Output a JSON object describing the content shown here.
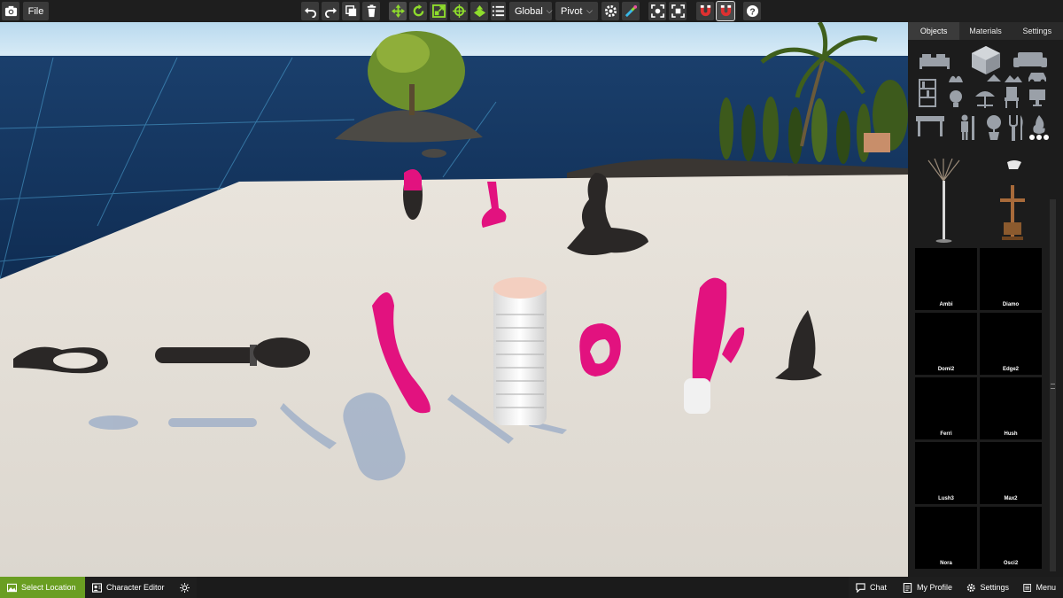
{
  "toolbar": {
    "file_label": "File",
    "space_select": "Global",
    "pivot_select": "Pivot",
    "help_label": "?"
  },
  "panel": {
    "tabs": [
      {
        "label": "Objects"
      },
      {
        "label": "Materials"
      },
      {
        "label": "Settings"
      }
    ],
    "thumbnails": [
      {
        "label": "Ambi"
      },
      {
        "label": "Diamo"
      },
      {
        "label": "Domi2"
      },
      {
        "label": "Edge2"
      },
      {
        "label": "Ferri"
      },
      {
        "label": "Hush"
      },
      {
        "label": "Lush3"
      },
      {
        "label": "Max2"
      },
      {
        "label": "Nora"
      },
      {
        "label": "Osci2"
      }
    ]
  },
  "bottom": {
    "select_location": "Select Location",
    "character_editor": "Character Editor",
    "chat": "Chat",
    "my_profile": "My Profile",
    "settings": "Settings",
    "menu": "Menu"
  },
  "colors": {
    "accent_green": "#6a9e22",
    "toy_pink": "#e2127f",
    "toy_black": "#2a2726"
  }
}
